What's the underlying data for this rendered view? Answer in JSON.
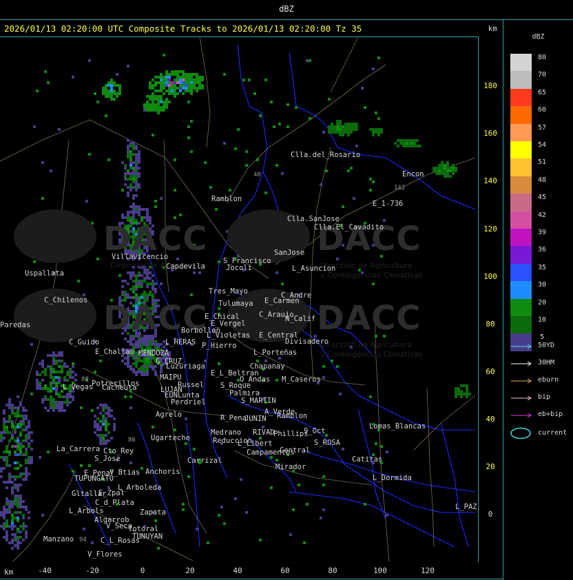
{
  "window": {
    "title": "dBZ"
  },
  "header": {
    "title": "2026/01/13 02:20:00 UTC Composite Tracks to 2026/01/13 02:20:00 Tz 35",
    "units": "km"
  },
  "axes": {
    "y_ticks": [
      "180",
      "160",
      "140",
      "120",
      "100",
      "80",
      "60",
      "40",
      "20",
      "0"
    ],
    "x_ticks": [
      "-40",
      "-20",
      "0",
      "20",
      "40",
      "60",
      "80",
      "100",
      "120"
    ],
    "x_unit": "km"
  },
  "legend": {
    "title": "dBZ",
    "levels": [
      {
        "value": "80",
        "color": "#d4d4d4"
      },
      {
        "value": "70",
        "color": "#bdbdbd"
      },
      {
        "value": "65",
        "color": "#ff3a1f"
      },
      {
        "value": "60",
        "color": "#ff6a00"
      },
      {
        "value": "57",
        "color": "#ff9a57"
      },
      {
        "value": "54",
        "color": "#ffff00"
      },
      {
        "value": "51",
        "color": "#ffc12e"
      },
      {
        "value": "48",
        "color": "#d98a3a"
      },
      {
        "value": "45",
        "color": "#c86b86"
      },
      {
        "value": "42",
        "color": "#d54fa0"
      },
      {
        "value": "39",
        "color": "#c012c0"
      },
      {
        "value": "36",
        "color": "#7a18d8"
      },
      {
        "value": "35",
        "color": "#2a50ff"
      },
      {
        "value": "30",
        "color": "#1e8cff"
      },
      {
        "value": "20",
        "color": "#0f8a0f"
      },
      {
        "value": "10",
        "color": "#0b6a0b"
      },
      {
        "value": "5",
        "color": "#4a3a8a"
      }
    ],
    "tracks": [
      {
        "label": "50YD",
        "color": "#39e6e6"
      },
      {
        "label": "30HM",
        "color": "#ffffff"
      },
      {
        "label": "eburn",
        "color": "#e8b060"
      },
      {
        "label": "bip",
        "color": "#ffc4c4"
      },
      {
        "label": "eb+bip",
        "color": "#e040e0"
      }
    ],
    "current": {
      "label": "current",
      "color": "#3cdcdc"
    }
  },
  "watermark": {
    "logo_text": "DACC",
    "line1": "Dirección de Agricultura",
    "line2": "y Contingencias Climáticas"
  },
  "places": [
    {
      "name": "Clla.del_Rosario"
    },
    {
      "name": "Encon"
    },
    {
      "name": "E_1-736"
    },
    {
      "name": "Ramblon"
    },
    {
      "name": "Clla.SanJose"
    },
    {
      "name": "Clla.El_Cavadito"
    },
    {
      "name": "Uspallata"
    },
    {
      "name": "Villavicencio"
    },
    {
      "name": "Capdevila"
    },
    {
      "name": "S_Francisco"
    },
    {
      "name": "Jocoli"
    },
    {
      "name": "SanJose"
    },
    {
      "name": "L_Asuncion"
    },
    {
      "name": "C_Chilenos"
    },
    {
      "name": "Tres_Mayo"
    },
    {
      "name": "Tulumaya"
    },
    {
      "name": "C_Andre"
    },
    {
      "name": "E_Carmen"
    },
    {
      "name": "E_Chical"
    },
    {
      "name": "E_Vergel"
    },
    {
      "name": "C_Araujo"
    },
    {
      "name": "N_Calif"
    },
    {
      "name": "Paredas"
    },
    {
      "name": "Borbollon"
    },
    {
      "name": "L_Violetas"
    },
    {
      "name": "E_Central"
    },
    {
      "name": "Divisadero"
    },
    {
      "name": "C_Guido"
    },
    {
      "name": "L_HERAS"
    },
    {
      "name": "P_Hierro"
    },
    {
      "name": "E_Challao"
    },
    {
      "name": "MENDOZA"
    },
    {
      "name": "L_Porteñas"
    },
    {
      "name": "G_CRUZ"
    },
    {
      "name": "Luzuriaga"
    },
    {
      "name": "E_L_Beltran"
    },
    {
      "name": "Chapanay"
    },
    {
      "name": "MAIPU"
    },
    {
      "name": "O_Andas"
    },
    {
      "name": "M_Caseros"
    },
    {
      "name": "Potrerillos"
    },
    {
      "name": "Russel"
    },
    {
      "name": "S_Roque"
    },
    {
      "name": "L_Vegas"
    },
    {
      "name": "Cacheuta"
    },
    {
      "name": "LUJAN"
    },
    {
      "name": "Palmira"
    },
    {
      "name": "LUNLunta"
    },
    {
      "name": "S_MARTIN"
    },
    {
      "name": "Perdriel"
    },
    {
      "name": "A_Verde"
    },
    {
      "name": "Agrelo"
    },
    {
      "name": "Ramblon"
    },
    {
      "name": "R_Pena"
    },
    {
      "name": "JUNIN"
    },
    {
      "name": "Ugarteche"
    },
    {
      "name": "Medrano"
    },
    {
      "name": "RIVAD"
    },
    {
      "name": "Phillips"
    },
    {
      "name": "9_Oct"
    },
    {
      "name": "Reduccion"
    },
    {
      "name": "Lomas_Blancas"
    },
    {
      "name": "La_Carrera"
    },
    {
      "name": "Cto_Rey"
    },
    {
      "name": "L_Libert"
    },
    {
      "name": "S_ROSA"
    },
    {
      "name": "S_Jose"
    },
    {
      "name": "Carrizal"
    },
    {
      "name": "Campamentos"
    },
    {
      "name": "Central"
    },
    {
      "name": "Catitas"
    },
    {
      "name": "E_Pena"
    },
    {
      "name": "V_Btias"
    },
    {
      "name": "Anchoris"
    },
    {
      "name": "Mirador"
    },
    {
      "name": "TUPUNGATO"
    },
    {
      "name": "L_Dormida"
    },
    {
      "name": "L_Arboleda"
    },
    {
      "name": "Gltallar"
    },
    {
      "name": "E_Zpal"
    },
    {
      "name": "C_d_Plata"
    },
    {
      "name": "L_Arbols"
    },
    {
      "name": "Zapata"
    },
    {
      "name": "L_PAZ"
    },
    {
      "name": "Algarrob"
    },
    {
      "name": "V_Seca"
    },
    {
      "name": "Totoral"
    },
    {
      "name": "TUNUYAN"
    },
    {
      "name": "Manzano"
    },
    {
      "name": "C_L_Rosas"
    },
    {
      "name": "V_Flores"
    }
  ],
  "route_labels": [
    "40",
    "142",
    "88",
    "86",
    "94"
  ]
}
